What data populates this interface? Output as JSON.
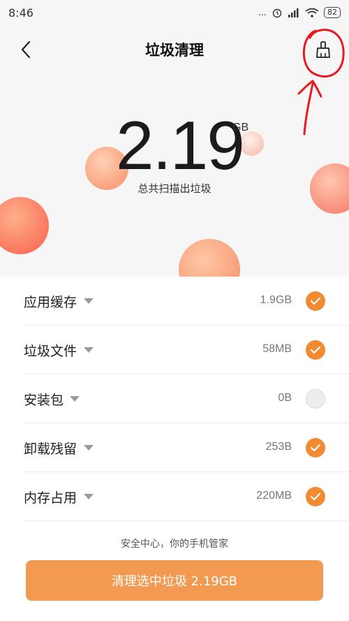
{
  "status_bar": {
    "time": "8:46",
    "dots": "...",
    "battery": "82"
  },
  "header": {
    "title": "垃圾清理"
  },
  "summary": {
    "value": "2.19",
    "unit": "GB",
    "caption": "总共扫描出垃圾"
  },
  "items": [
    {
      "label": "应用缓存",
      "size": "1.9GB",
      "checked": true
    },
    {
      "label": "垃圾文件",
      "size": "58MB",
      "checked": true
    },
    {
      "label": "安装包",
      "size": "0B",
      "checked": false
    },
    {
      "label": "卸载残留",
      "size": "253B",
      "checked": true
    },
    {
      "label": "内存占用",
      "size": "220MB",
      "checked": true
    }
  ],
  "footer": {
    "text": "安全中心，你的手机管家"
  },
  "primary_button": {
    "label": "清理选中垃圾 2.19GB"
  },
  "icons": [
    "back-arrow-icon",
    "clean-brush-icon",
    "caret-down-icon",
    "check-icon",
    "wifi-icon",
    "signal-icon",
    "alarm-icon"
  ],
  "colors": {
    "accent": "#f28a32",
    "button": "#f39a52",
    "annotation": "#e8191e"
  }
}
